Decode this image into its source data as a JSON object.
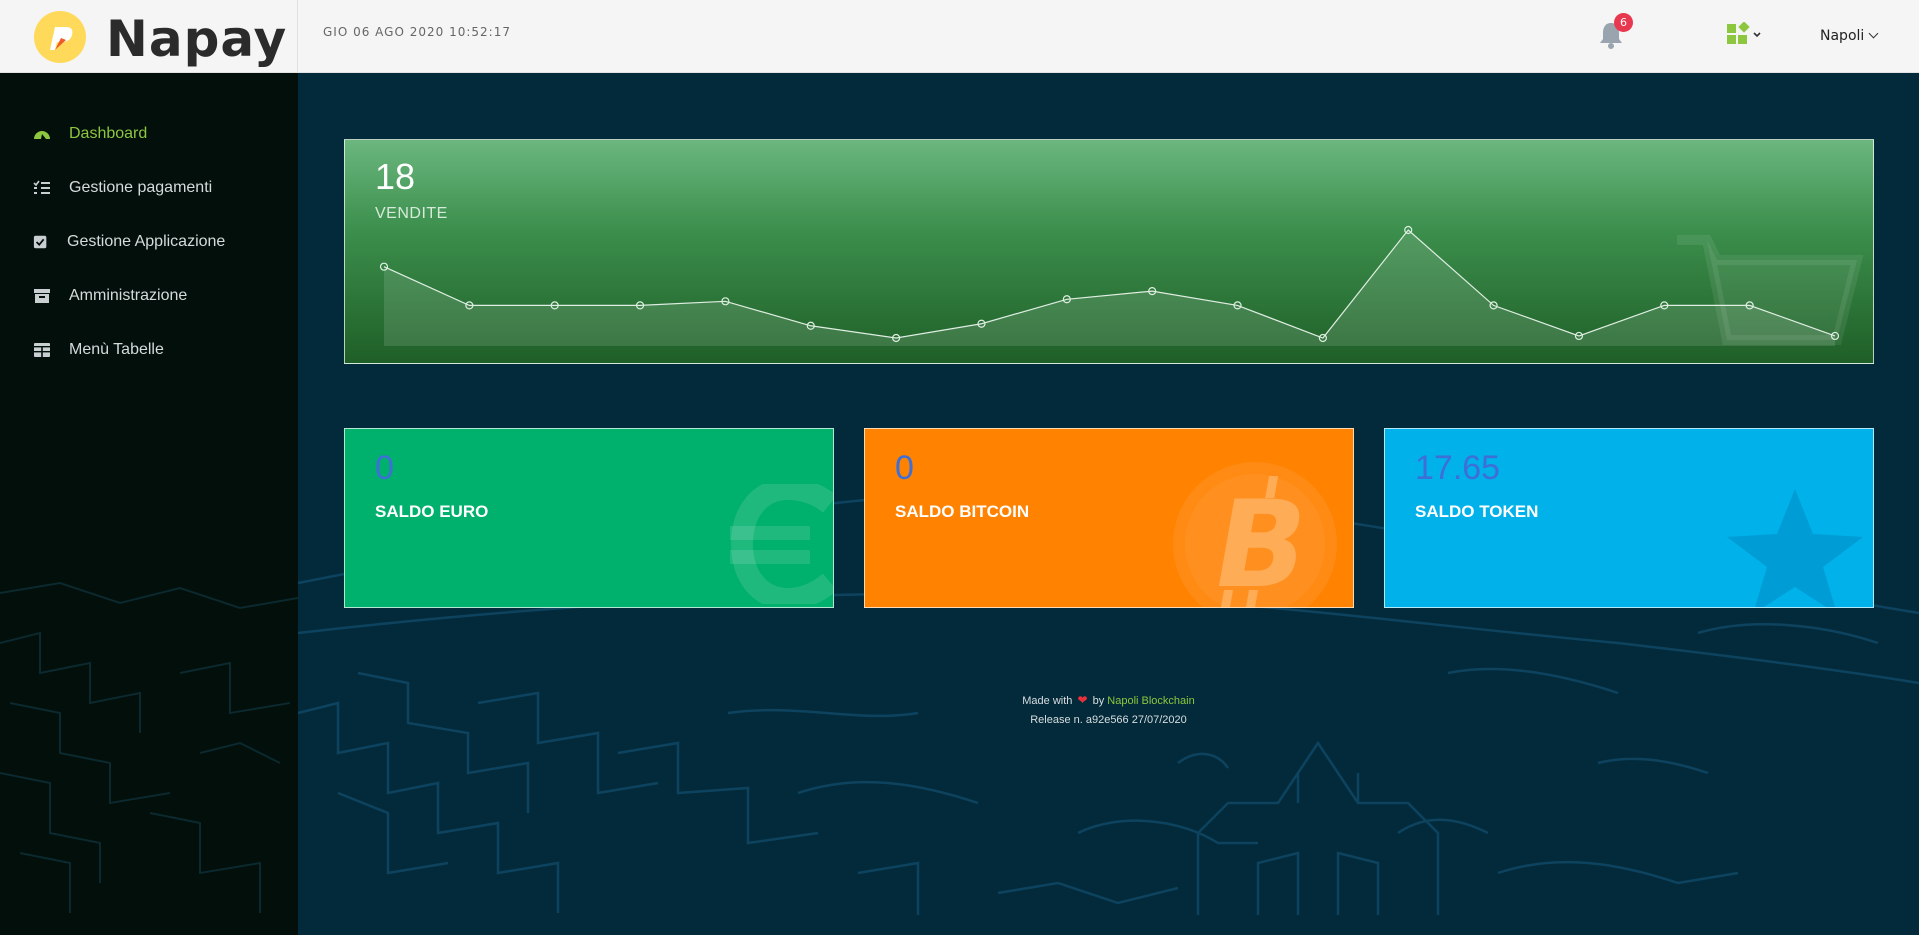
{
  "header": {
    "brand_name": "Napay",
    "datetime": "GIO 06 AGO 2020 10:52:17",
    "notifications_count": "6",
    "user_name": "Napoli"
  },
  "sidebar": {
    "items": [
      {
        "label": "Dashboard",
        "icon": "dashboard-gauge-icon",
        "active": true
      },
      {
        "label": "Gestione pagamenti",
        "icon": "checklist-icon",
        "active": false
      },
      {
        "label": "Gestione Applicazione",
        "icon": "checkbox-icon",
        "active": false
      },
      {
        "label": "Amministrazione",
        "icon": "archive-icon",
        "active": false
      },
      {
        "label": "Menù Tabelle",
        "icon": "table-icon",
        "active": false
      }
    ]
  },
  "vendite": {
    "value": "18",
    "label": "VENDITE"
  },
  "chart_data": {
    "type": "line",
    "title": "",
    "series": [
      {
        "values": [
          4.5,
          2.6,
          2.6,
          2.6,
          2.8,
          1.6,
          1.0,
          1.7,
          2.9,
          3.3,
          2.6,
          1.0,
          6.3,
          2.6,
          1.1,
          2.6,
          2.6,
          1.1
        ]
      }
    ],
    "grid": false,
    "legend": "none",
    "color": "#dfeee2"
  },
  "saldi": [
    {
      "value": "0",
      "label": "SALDO EURO",
      "icon": "euro-icon",
      "color": "#00b06d"
    },
    {
      "value": "0",
      "label": "SALDO BITCOIN",
      "icon": "bitcoin-icon",
      "color": "#ff8200"
    },
    {
      "value": "17.65",
      "label": "SALDO TOKEN",
      "icon": "star-icon",
      "color": "#00b1ea"
    }
  ],
  "footer": {
    "made_with": "Made with",
    "by": "by",
    "company": "Napoli Blockchain",
    "release": "Release n. a92e566 27/07/2020"
  },
  "colors": {
    "accent": "#8dc63f",
    "badge": "#e8384f",
    "main_bg": "#032a3a"
  }
}
